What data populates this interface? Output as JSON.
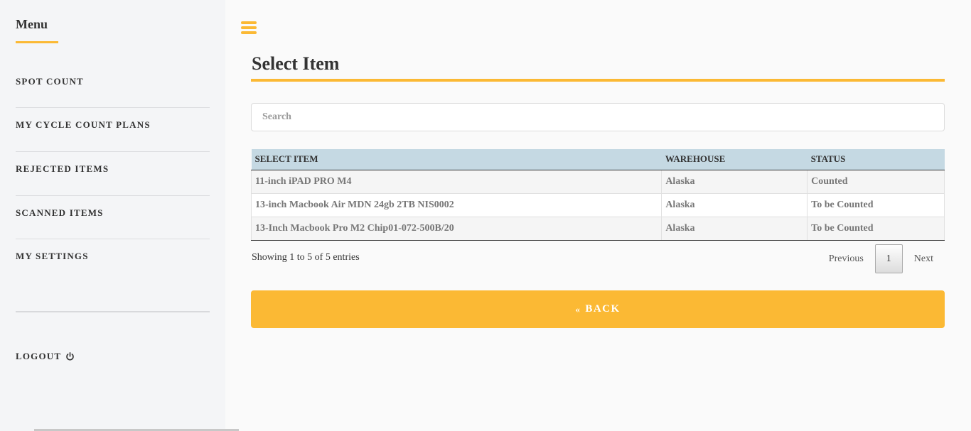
{
  "sidebar": {
    "title": "Menu",
    "items": [
      {
        "label": "SPOT COUNT"
      },
      {
        "label": "MY CYCLE COUNT PLANS"
      },
      {
        "label": "REJECTED ITEMS"
      },
      {
        "label": "SCANNED ITEMS"
      },
      {
        "label": "MY SETTINGS"
      }
    ],
    "logout_label": "LOGOUT",
    "logout_icon": "power-icon"
  },
  "main": {
    "menu_icon": "hamburger-icon",
    "title": "Select Item",
    "search": {
      "placeholder": "Search",
      "value": ""
    },
    "table": {
      "headers": [
        "SELECT ITEM",
        "WAREHOUSE",
        "STATUS"
      ],
      "rows": [
        {
          "item": "11-inch iPAD PRO M4",
          "warehouse": "Alaska",
          "status": "Counted"
        },
        {
          "item": "13-inch Macbook Air MDN 24gb 2TB NIS0002",
          "warehouse": "Alaska",
          "status": "To be Counted"
        },
        {
          "item": "13-Inch Macbook Pro M2 Chip01-072-500B/20",
          "warehouse": "Alaska",
          "status": "To be Counted"
        }
      ]
    },
    "showing_text": "Showing 1 to 5 of 5 entries",
    "pagination": {
      "previous": "Previous",
      "current": "1",
      "next": "Next"
    },
    "back_label": "BACK",
    "back_icon": "double-chevron-left-icon"
  },
  "colors": {
    "accent": "#fbb934",
    "table_header": "#c5d9e3",
    "sidebar_bg": "#f4f5f7"
  }
}
